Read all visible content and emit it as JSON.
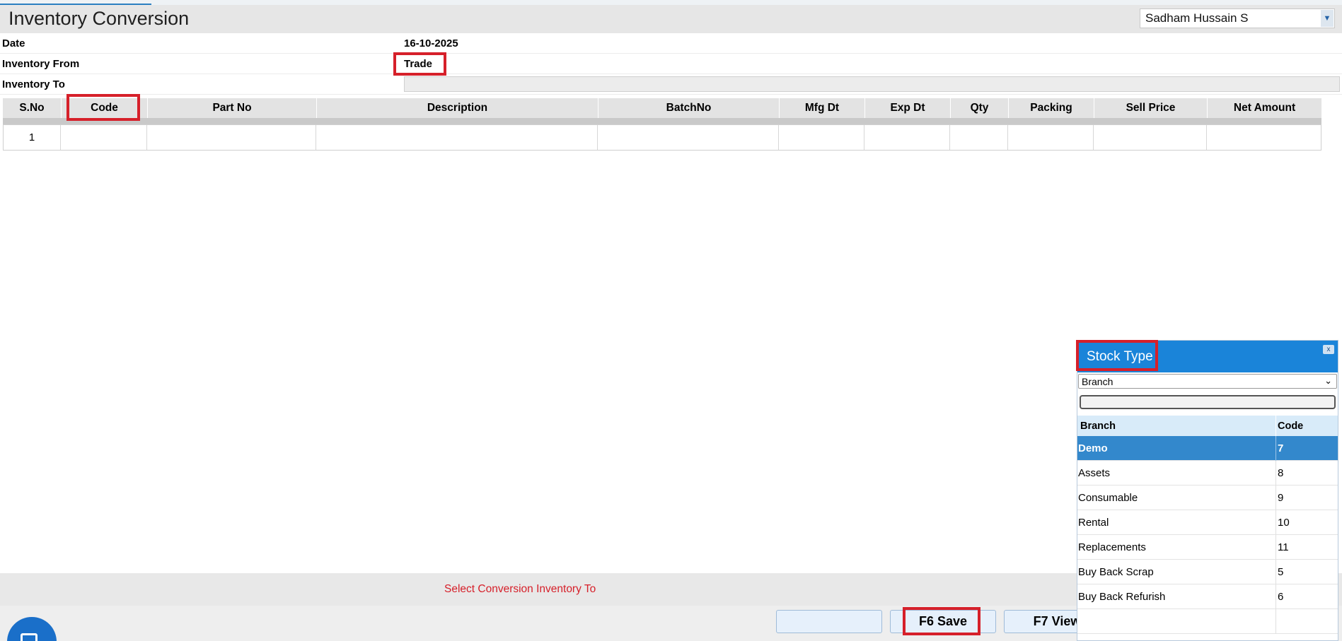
{
  "app": {
    "title": "Inventory Conversion",
    "user": "Sadham Hussain S"
  },
  "form": {
    "date_label": "Date",
    "date_value": "16-10-2025",
    "from_label": "Inventory From",
    "from_value": "Trade",
    "to_label": "Inventory To",
    "to_value": ""
  },
  "grid": {
    "columns": [
      "S.No",
      "Code",
      "Part No",
      "Description",
      "BatchNo",
      "Mfg Dt",
      "Exp Dt",
      "Qty",
      "Packing",
      "Sell Price",
      "Net Amount"
    ],
    "rows": [
      [
        "1",
        "",
        "",
        "",
        "",
        "",
        "",
        "",
        "",
        "",
        ""
      ]
    ]
  },
  "status": {
    "message": "Select Conversion Inventory To"
  },
  "buttons": {
    "blank": "",
    "save": "F6 Save",
    "view": "F7 View"
  },
  "popup": {
    "title": "Stock Type",
    "close_label": "x",
    "filter_value": "Branch",
    "search_value": "",
    "headers": [
      "Branch",
      "Code"
    ],
    "rows": [
      [
        "Demo",
        "7"
      ],
      [
        "Assets",
        "8"
      ],
      [
        "Consumable",
        "9"
      ],
      [
        "Rental",
        "10"
      ],
      [
        "Replacements",
        "11"
      ],
      [
        "Buy Back Scrap",
        "5"
      ],
      [
        "Buy Back Refurish",
        "6"
      ],
      [
        "",
        ""
      ]
    ],
    "selected_index": 0
  },
  "colors": {
    "accent": "#1a84d9",
    "highlight": "#d6202a",
    "selected_row": "#3388cc"
  },
  "icons": {
    "user_dropdown": "chevron-down-icon",
    "popup_close": "close-icon",
    "fab": "chat-icon"
  }
}
